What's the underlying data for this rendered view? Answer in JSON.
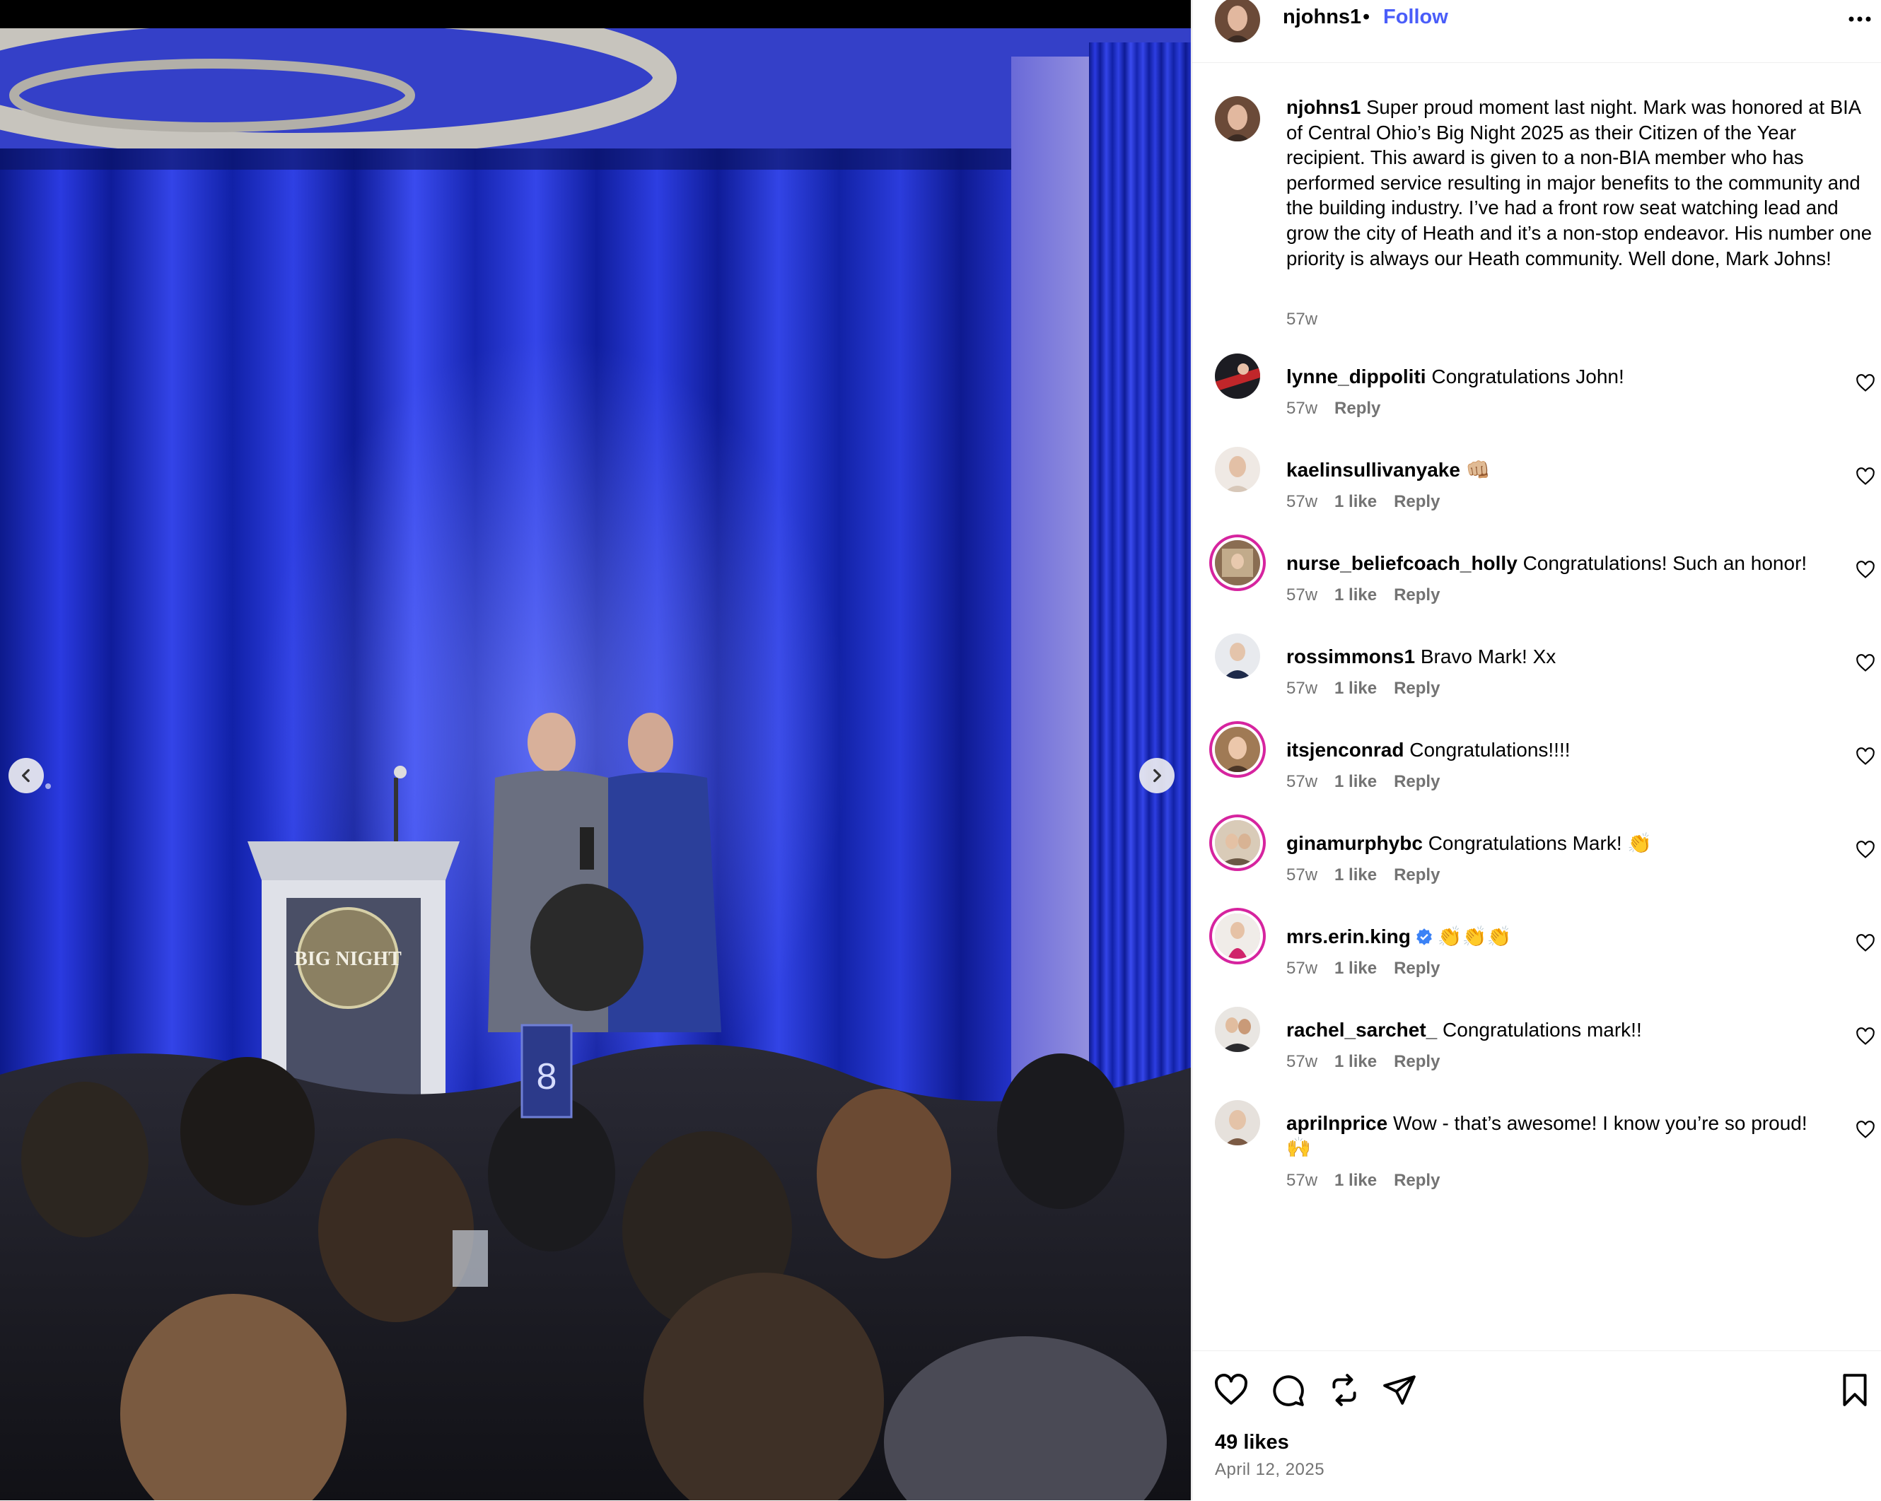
{
  "post": {
    "username": "njohns1",
    "separator": "•",
    "follow_label": "Follow",
    "caption_username": "njohns1",
    "caption_text": "Super proud moment last night. Mark was honored at BIA of Central Ohio’s Big Night 2025 as their Citizen of the Year recipient. This award is given to a non-BIA member who has performed service resulting in major benefits to the community and the building industry. I’ve had a front row seat watching lead and grow the city of Heath and it’s a non-stop endeavor. His number one priority is always our Heath community. Well done, Mark Johns!",
    "caption_time": "57w",
    "likes": "49 likes",
    "date": "April 12, 2025"
  },
  "photo": {
    "podium_logo": "BIG NIGHT",
    "table_number": "8"
  },
  "comments": [
    {
      "user": "lynne_dippoliti",
      "text": "Congratulations John!",
      "time": "57w",
      "likes": "",
      "reply": "Reply"
    },
    {
      "user": "kaelinsullivanyake",
      "text": "👊🏼",
      "time": "57w",
      "likes": "1 like",
      "reply": "Reply"
    },
    {
      "user": "nurse_beliefcoach_holly",
      "text": "Congratulations! Such an honor!",
      "time": "57w",
      "likes": "1 like",
      "reply": "Reply"
    },
    {
      "user": "rossimmons1",
      "text": "Bravo Mark! Xx",
      "time": "57w",
      "likes": "1 like",
      "reply": "Reply"
    },
    {
      "user": "itsjenconrad",
      "text": "Congratulations!!!!",
      "time": "57w",
      "likes": "1 like",
      "reply": "Reply"
    },
    {
      "user": "ginamurphybc",
      "text": "Congratulations Mark! 👏",
      "time": "57w",
      "likes": "1 like",
      "reply": "Reply"
    },
    {
      "user": "mrs.erin.king",
      "text": "👏👏👏",
      "time": "57w",
      "likes": "1 like",
      "reply": "Reply"
    },
    {
      "user": "rachel_sarchet_",
      "text": "Congratulations mark!!",
      "time": "57w",
      "likes": "1 like",
      "reply": "Reply"
    },
    {
      "user": "aprilnprice",
      "text": "Wow - that’s awesome! I know you’re so proud! 🙌",
      "time": "57w",
      "likes": "1 like",
      "reply": "Reply"
    }
  ],
  "colors": {
    "follow": "#4a5df9",
    "meta_text": "#737373",
    "story_ring": "#d6249f",
    "verified": "#3b82f6"
  },
  "icons": [
    "more-options-icon",
    "chevron-left-icon",
    "chevron-right-icon",
    "heart-icon",
    "comment-icon",
    "repost-icon",
    "share-icon",
    "bookmark-icon",
    "verified-badge-icon"
  ]
}
